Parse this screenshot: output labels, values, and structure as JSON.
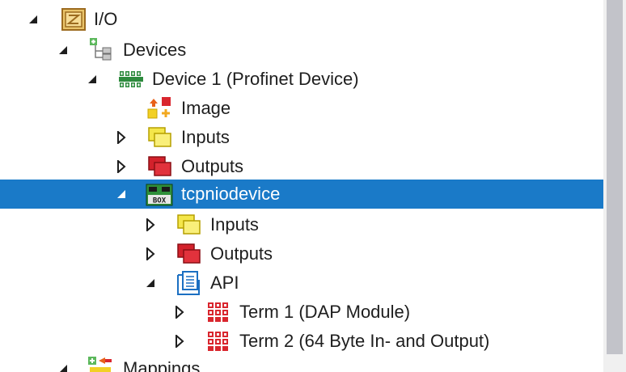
{
  "tree": {
    "rows": [
      {
        "label": "I/O",
        "expander": "expanded",
        "icon": "io-folder-icon"
      },
      {
        "label": "Devices",
        "expander": "expanded",
        "icon": "devices-tree-icon"
      },
      {
        "label": "Device 1 (Profinet Device)",
        "expander": "expanded",
        "icon": "profinet-device-icon"
      },
      {
        "label": "Image",
        "expander": "none",
        "icon": "image-icon"
      },
      {
        "label": "Inputs",
        "expander": "collapsed",
        "icon": "inputs-icon"
      },
      {
        "label": "Outputs",
        "expander": "collapsed",
        "icon": "outputs-icon"
      },
      {
        "label": "tcpniodevice",
        "expander": "expanded",
        "icon": "box-module-icon",
        "selected": true
      },
      {
        "label": "Inputs",
        "expander": "collapsed",
        "icon": "inputs-icon"
      },
      {
        "label": "Outputs",
        "expander": "collapsed",
        "icon": "outputs-icon"
      },
      {
        "label": "API",
        "expander": "expanded",
        "icon": "api-icon"
      },
      {
        "label": "Term 1 (DAP Module)",
        "expander": "collapsed",
        "icon": "term-icon"
      },
      {
        "label": "Term 2 (64 Byte In- and Output)",
        "expander": "collapsed",
        "icon": "term-icon"
      },
      {
        "label": "Mappings",
        "expander": "expanded",
        "icon": "mappings-icon"
      }
    ]
  },
  "colors": {
    "selection": "#1a7ac8",
    "text": "#1e1e1e",
    "selected_text": "#ffffff"
  }
}
